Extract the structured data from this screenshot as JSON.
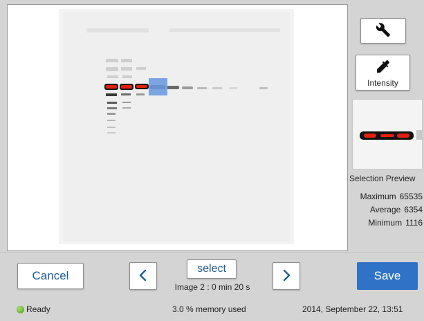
{
  "viewer": {
    "image_name": "western-blot-image",
    "selection_box_color": "#6e9be0"
  },
  "tools": {
    "settings_icon": "wrench-icon",
    "intensity_icon": "eyedropper-icon",
    "intensity_label": "Intensity"
  },
  "preview": {
    "title": "Selection Preview",
    "stats": [
      {
        "label": "Maximum",
        "value": "65535"
      },
      {
        "label": "Average",
        "value": "6354"
      },
      {
        "label": "Minimum",
        "value": "1116"
      }
    ]
  },
  "actions": {
    "cancel_label": "Cancel",
    "select_label": "select",
    "image_info": "Image 2 : 0 min 20 s",
    "save_label": "Save",
    "prev_icon": "chevron-left-icon",
    "next_icon": "chevron-right-icon"
  },
  "status": {
    "state": "Ready",
    "memory": "3.0 % memory used",
    "datetime": "2014, September 22, 13:51",
    "ready_color": "#5aa82a"
  },
  "colors": {
    "accent": "#2f73c6",
    "link_text": "#1e5b9a",
    "saturation": "#e02010"
  }
}
